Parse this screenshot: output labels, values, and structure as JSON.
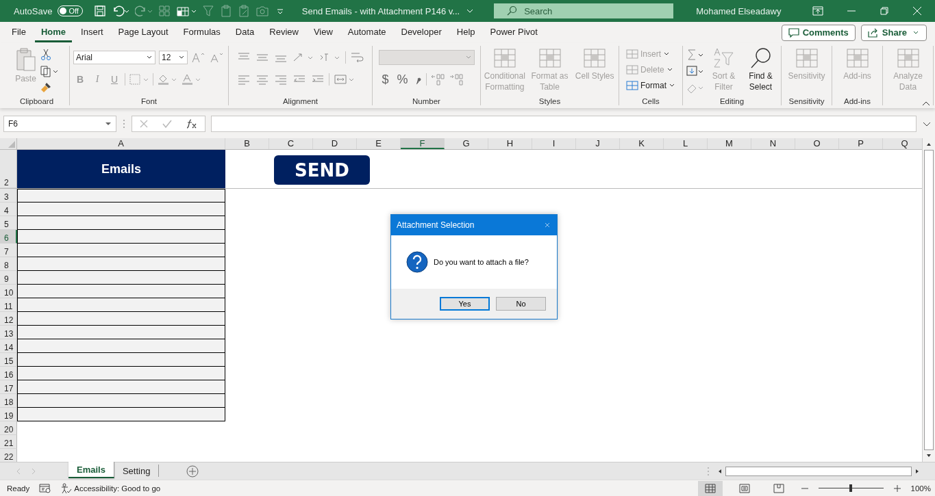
{
  "title_bar": {
    "autosave_label": "AutoSave",
    "autosave": {
      "on": false,
      "label": "Off"
    },
    "document_title": "Send Emails - with Attachment P146 v...",
    "search_placeholder": "Search",
    "user_name": "Mohamed Elseadawy"
  },
  "menu_tabs": [
    {
      "label": "File",
      "selected": false
    },
    {
      "label": "Home",
      "selected": true
    },
    {
      "label": "Insert",
      "selected": false
    },
    {
      "label": "Page Layout",
      "selected": false
    },
    {
      "label": "Formulas",
      "selected": false
    },
    {
      "label": "Data",
      "selected": false
    },
    {
      "label": "Review",
      "selected": false
    },
    {
      "label": "View",
      "selected": false
    },
    {
      "label": "Automate",
      "selected": false
    },
    {
      "label": "Developer",
      "selected": false
    },
    {
      "label": "Help",
      "selected": false
    },
    {
      "label": "Power Pivot",
      "selected": false
    }
  ],
  "menu_actions": [
    {
      "kind": "comments",
      "label": "Comments"
    },
    {
      "kind": "share",
      "label": "Share"
    }
  ],
  "ribbon": {
    "groups": [
      {
        "kind": "clipboard",
        "label": "Clipboard",
        "paste": {
          "label": "Paste",
          "disabled": true
        }
      },
      {
        "kind": "font",
        "label": "Font",
        "font_name": "Arial",
        "font_size": "12",
        "style_buttons": [
          "B",
          "I",
          "U"
        ]
      },
      {
        "kind": "alignment",
        "label": "Alignment"
      },
      {
        "kind": "number",
        "label": "Number",
        "format_buttons": [
          "$",
          "%"
        ]
      },
      {
        "kind": "large",
        "label": "Styles",
        "buttons": [
          {
            "label": "Conditional Formatting",
            "disabled": true
          },
          {
            "label": "Format as Table",
            "disabled": true
          },
          {
            "label": "Cell Styles",
            "disabled": true
          }
        ]
      },
      {
        "kind": "cells",
        "label": "Cells",
        "buttons": [
          {
            "label": "Insert",
            "disabled": true
          },
          {
            "label": "Delete",
            "disabled": true
          },
          {
            "label": "Format",
            "disabled": false
          }
        ]
      },
      {
        "kind": "editing",
        "label": "Editing",
        "buttons": [
          {
            "label": "Sort & Filter",
            "disabled": true
          },
          {
            "label": "Find & Select",
            "disabled": false
          }
        ]
      },
      {
        "kind": "large",
        "label": "Sensitivity",
        "buttons": [
          {
            "label": "Sensitivity",
            "disabled": true
          }
        ]
      },
      {
        "kind": "large",
        "label": "Add-ins",
        "buttons": [
          {
            "label": "Add-ins",
            "disabled": true
          }
        ]
      },
      {
        "kind": "large",
        "buttons": [
          {
            "label": "Analyze Data",
            "disabled": true
          }
        ]
      }
    ]
  },
  "formula_bar": {
    "name_box": "F6"
  },
  "sheet": {
    "columns": [
      {
        "label": "A",
        "selected": false
      },
      {
        "label": "B",
        "selected": false
      },
      {
        "label": "C",
        "selected": false
      },
      {
        "label": "D",
        "selected": false
      },
      {
        "label": "E",
        "selected": false
      },
      {
        "label": "F",
        "selected": true
      },
      {
        "label": "G",
        "selected": false
      },
      {
        "label": "H",
        "selected": false
      },
      {
        "label": "I",
        "selected": false
      },
      {
        "label": "J",
        "selected": false
      },
      {
        "label": "K",
        "selected": false
      },
      {
        "label": "L",
        "selected": false
      },
      {
        "label": "M",
        "selected": false
      },
      {
        "label": "N",
        "selected": false
      },
      {
        "label": "O",
        "selected": false
      },
      {
        "label": "P",
        "selected": false
      },
      {
        "label": "Q",
        "selected": false
      }
    ],
    "rows": [
      {
        "label": "2",
        "selected": false,
        "bordered": false
      },
      {
        "label": "3",
        "selected": false,
        "bordered": true
      },
      {
        "label": "4",
        "selected": false,
        "bordered": true
      },
      {
        "label": "5",
        "selected": false,
        "bordered": true
      },
      {
        "label": "6",
        "selected": true,
        "bordered": true
      },
      {
        "label": "7",
        "selected": false,
        "bordered": true
      },
      {
        "label": "8",
        "selected": false,
        "bordered": true
      },
      {
        "label": "9",
        "selected": false,
        "bordered": true
      },
      {
        "label": "10",
        "selected": false,
        "bordered": true
      },
      {
        "label": "11",
        "selected": false,
        "bordered": true
      },
      {
        "label": "12",
        "selected": false,
        "bordered": true
      },
      {
        "label": "13",
        "selected": false,
        "bordered": true
      },
      {
        "label": "14",
        "selected": false,
        "bordered": true
      },
      {
        "label": "15",
        "selected": false,
        "bordered": true
      },
      {
        "label": "16",
        "selected": false,
        "bordered": true
      },
      {
        "label": "17",
        "selected": false,
        "bordered": true
      },
      {
        "label": "18",
        "selected": false,
        "bordered": true
      },
      {
        "label": "19",
        "selected": false,
        "bordered": true
      },
      {
        "label": "20",
        "selected": false,
        "bordered": false
      },
      {
        "label": "21",
        "selected": false,
        "bordered": false
      },
      {
        "label": "22",
        "selected": false,
        "bordered": false
      }
    ],
    "header_cell": "Emails",
    "send_button": "SEND"
  },
  "dialog": {
    "title": "Attachment Selection",
    "message": "Do you want to attach a file?",
    "buttons": [
      {
        "label": "Yes",
        "default": true
      },
      {
        "label": "No",
        "default": false
      }
    ]
  },
  "sheet_tabs": [
    {
      "label": "Emails",
      "selected": true
    },
    {
      "label": "Setting",
      "selected": false
    }
  ],
  "status_bar": {
    "status": "Ready",
    "accessibility": "Accessibility: Good to go",
    "zoom": {
      "level": 0.5,
      "label": "100%"
    }
  }
}
